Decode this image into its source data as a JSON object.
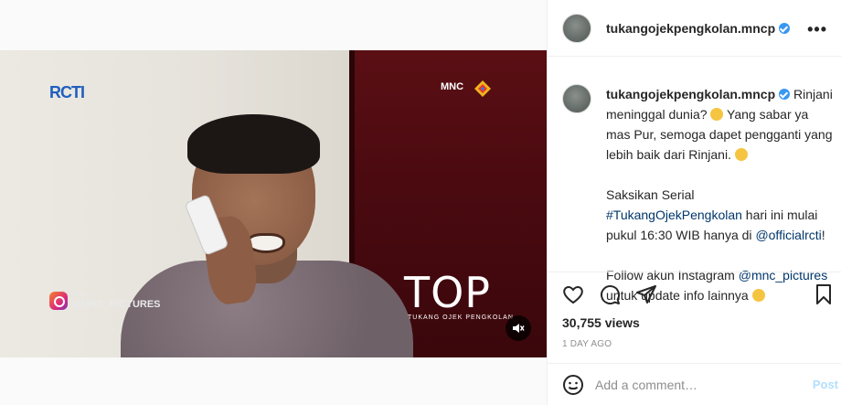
{
  "post": {
    "username": "tukangojekpengkolan.mncp",
    "more_label": "•••",
    "caption_line1": " Rinjani meninggal dunia? ",
    "caption_line2": " Yang sabar ya mas Pur, semoga dapet pengganti yang lebih baik dari Rinjani. ",
    "caption_p2_a": "Saksikan Serial ",
    "hashtag": "#TukangOjekPengkolan",
    "caption_p2_b": " hari ini mulai pukul 16:30 WIB hanya di ",
    "mention_rcti": "@officialrcti",
    "caption_p2_c": "!",
    "caption_p3_a": "Follow akun Instagram ",
    "mention_mnc": "@mnc_pictures",
    "caption_p3_b": " untuk update info lainnya ",
    "views": "30,755 views",
    "time_ago": "1 DAY AGO"
  },
  "video": {
    "rcti_logo": "RCTI",
    "mnc_logo": "MNC",
    "title_big": "TOP",
    "title_sub": "TUKANG OJEK PENGKOLAN",
    "follow_small": "Follow",
    "follow_handle": "@MNC_PICTURES"
  },
  "comment": {
    "placeholder": "Add a comment…",
    "post_label": "Post"
  },
  "colors": {
    "verified": "#3897f0",
    "link": "#00376b",
    "post_disabled": "#b2dffc"
  },
  "icons": [
    "heart-icon",
    "comment-icon",
    "share-icon",
    "bookmark-icon",
    "mute-icon",
    "smile-icon",
    "verified-icon",
    "more-icon",
    "instagram-icon"
  ]
}
